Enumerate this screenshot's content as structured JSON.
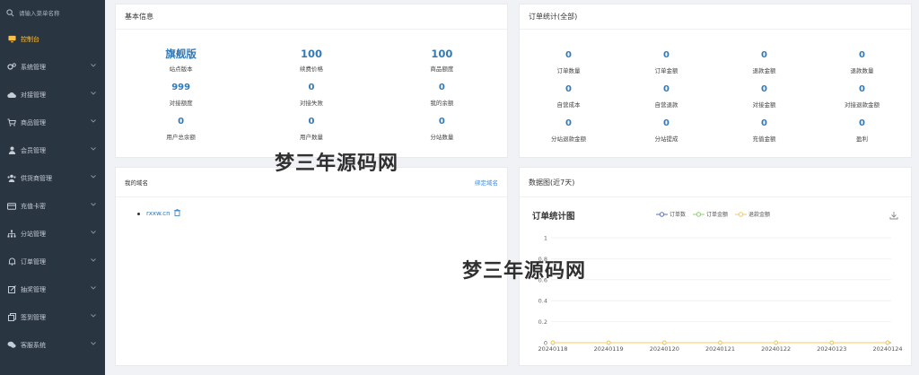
{
  "sidebar": {
    "search_placeholder": "请输入菜单名称",
    "items": [
      {
        "label": "控制台",
        "icon": "monitor-icon",
        "active": true
      },
      {
        "label": "系统管理",
        "icon": "gears-icon"
      },
      {
        "label": "对接管理",
        "icon": "cloud-icon"
      },
      {
        "label": "商品管理",
        "icon": "cart-icon"
      },
      {
        "label": "会员管理",
        "icon": "user-icon"
      },
      {
        "label": "供货商管理",
        "icon": "users-icon"
      },
      {
        "label": "充值卡密",
        "icon": "card-icon"
      },
      {
        "label": "分站管理",
        "icon": "sitemap-icon"
      },
      {
        "label": "订单管理",
        "icon": "bell-icon"
      },
      {
        "label": "抽奖管理",
        "icon": "edit-icon"
      },
      {
        "label": "签到管理",
        "icon": "copy-icon"
      },
      {
        "label": "客服系统",
        "icon": "chat-icon"
      }
    ]
  },
  "basic": {
    "title": "基本信息",
    "rows": [
      [
        {
          "value": "旗舰版",
          "label": "站点版本"
        },
        {
          "value": "100",
          "label": "续费价格"
        },
        {
          "value": "100",
          "label": "商品额度"
        }
      ],
      [
        {
          "value": "999",
          "label": "对接额度"
        },
        {
          "value": "0",
          "label": "对接失败"
        },
        {
          "value": "0",
          "label": "我的余额"
        }
      ],
      [
        {
          "value": "0",
          "label": "用户总余额"
        },
        {
          "value": "0",
          "label": "用户数量"
        },
        {
          "value": "0",
          "label": "分站数量"
        }
      ]
    ]
  },
  "orders": {
    "title": "订单统计(全部)",
    "rows": [
      [
        {
          "value": "0",
          "label": "订单数量"
        },
        {
          "value": "0",
          "label": "订单金额"
        },
        {
          "value": "0",
          "label": "退款金额"
        },
        {
          "value": "0",
          "label": "退款数量"
        }
      ],
      [
        {
          "value": "0",
          "label": "自营成本"
        },
        {
          "value": "0",
          "label": "自营退款"
        },
        {
          "value": "0",
          "label": "对接金额"
        },
        {
          "value": "0",
          "label": "对接退款金额"
        }
      ],
      [
        {
          "value": "0",
          "label": "分站退款金额"
        },
        {
          "value": "0",
          "label": "分站提成"
        },
        {
          "value": "0",
          "label": "充值金额"
        },
        {
          "value": "0",
          "label": "盈利"
        }
      ]
    ]
  },
  "domain": {
    "title": "我的域名",
    "bind_label": "绑定域名",
    "domains": [
      "rxxw.cn"
    ]
  },
  "chart_panel": {
    "title": "数据图(近7天)",
    "chart_title": "订单统计图"
  },
  "watermark": "梦三年源码网",
  "colors": {
    "sidebar_bg": "#2a3542",
    "active": "#f5c04b",
    "value_blue": "#337ab7",
    "series_orders": "#5470c6",
    "series_amount": "#91cc75",
    "series_refund": "#fac858"
  },
  "chart_data": {
    "type": "line",
    "x": [
      "20240118",
      "20240119",
      "20240120",
      "20240121",
      "20240122",
      "20240123",
      "20240124"
    ],
    "series": [
      {
        "name": "订单数",
        "values": [
          0,
          0,
          0,
          0,
          0,
          0,
          0
        ]
      },
      {
        "name": "订单金额",
        "values": [
          0,
          0,
          0,
          0,
          0,
          0,
          0
        ]
      },
      {
        "name": "退款金额",
        "values": [
          0,
          0,
          0,
          0,
          0,
          0,
          0
        ]
      }
    ],
    "yticks": [
      "0",
      "0.2",
      "0.4",
      "0.6",
      "0.8",
      "1"
    ],
    "ylim": [
      0,
      1
    ],
    "legend": "top"
  }
}
